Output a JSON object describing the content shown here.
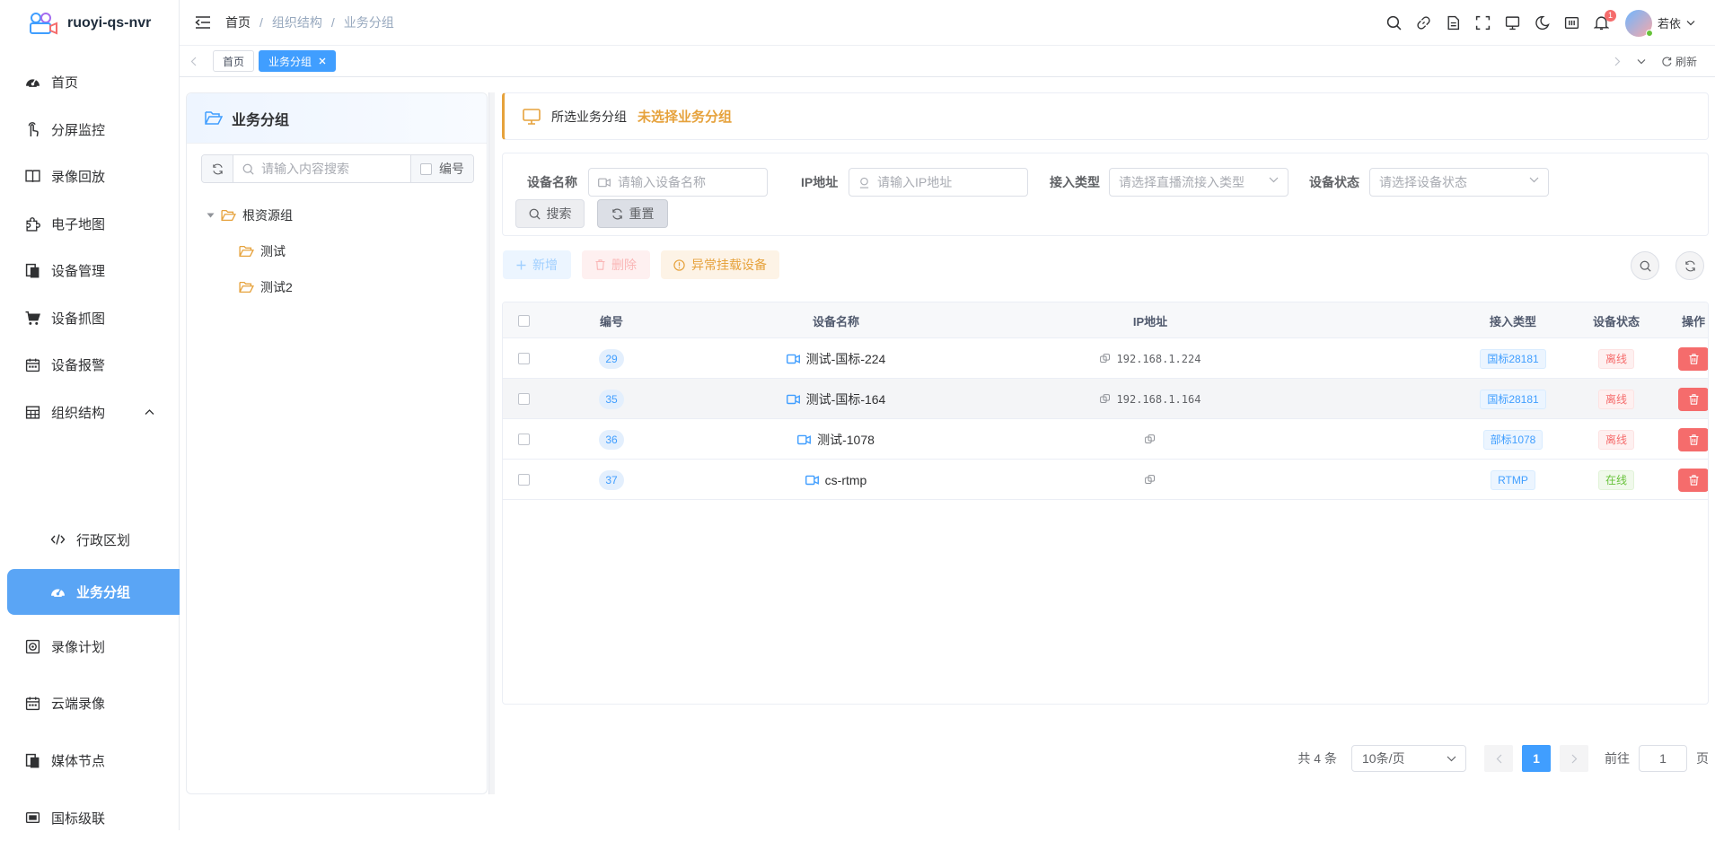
{
  "app": {
    "name": "ruoyi-qs-nvr"
  },
  "sidebar": {
    "items": [
      {
        "label": "首页",
        "icon": "dashboard-icon"
      },
      {
        "label": "分屏监控",
        "icon": "pointer-icon"
      },
      {
        "label": "录像回放",
        "icon": "book-icon"
      },
      {
        "label": "电子地图",
        "icon": "puzzle-icon"
      },
      {
        "label": "设备管理",
        "icon": "documents-icon"
      },
      {
        "label": "设备抓图",
        "icon": "cart-icon"
      },
      {
        "label": "设备报警",
        "icon": "calendar-icon"
      },
      {
        "label": "组织结构",
        "icon": "grid-icon",
        "expanded": true
      },
      {
        "label": "行政区划",
        "icon": "code-icon"
      },
      {
        "label": "业务分组",
        "icon": "dashboard-icon",
        "active": true
      },
      {
        "label": "录像计划",
        "icon": "safe-icon"
      },
      {
        "label": "云端录像",
        "icon": "calendar-icon"
      },
      {
        "label": "媒体节点",
        "icon": "documents-icon"
      },
      {
        "label": "国标级联",
        "icon": "screen-icon"
      }
    ]
  },
  "header": {
    "breadcrumb": [
      "首页",
      "组织结构",
      "业务分组"
    ],
    "notification_count": "1",
    "user_name": "若依"
  },
  "tags": {
    "items": [
      {
        "label": "首页"
      },
      {
        "label": "业务分组",
        "active": true
      }
    ],
    "refresh_label": "刷新"
  },
  "tree": {
    "title": "业务分组",
    "search_placeholder": "请输入内容搜索",
    "checkbox_label": "编号",
    "nodes": [
      {
        "label": "根资源组",
        "level": 0
      },
      {
        "label": "测试",
        "level": 1
      },
      {
        "label": "测试2",
        "level": 1
      }
    ]
  },
  "alert": {
    "label": "所选业务分组",
    "value": "未选择业务分组"
  },
  "filters": {
    "device_name": {
      "label": "设备名称",
      "placeholder": "请输入设备名称"
    },
    "ip": {
      "label": "IP地址",
      "placeholder": "请输入IP地址"
    },
    "access_type": {
      "label": "接入类型",
      "placeholder": "请选择直播流接入类型"
    },
    "status": {
      "label": "设备状态",
      "placeholder": "请选择设备状态"
    },
    "search_label": "搜索",
    "reset_label": "重置"
  },
  "toolbar": {
    "add_label": "新增",
    "delete_label": "删除",
    "abnormal_label": "异常挂载设备"
  },
  "table": {
    "columns": [
      "编号",
      "设备名称",
      "IP地址",
      "接入类型",
      "设备状态",
      "操作"
    ],
    "rows": [
      {
        "id": "29",
        "name": "测试-国标-224",
        "ip": "192.168.1.224",
        "type": "国标28181",
        "status": "离线",
        "status_kind": "offline"
      },
      {
        "id": "35",
        "name": "测试-国标-164",
        "ip": "192.168.1.164",
        "type": "国标28181",
        "status": "离线",
        "status_kind": "offline"
      },
      {
        "id": "36",
        "name": "测试-1078",
        "ip": "",
        "type": "部标1078",
        "status": "离线",
        "status_kind": "offline"
      },
      {
        "id": "37",
        "name": "cs-rtmp",
        "ip": "",
        "type": "RTMP",
        "status": "在线",
        "status_kind": "online"
      }
    ]
  },
  "pagination": {
    "total": "共 4 条",
    "page_size": "10条/页",
    "current": "1",
    "goto_prefix": "前往",
    "goto_value": "1",
    "goto_suffix": "页"
  },
  "colors": {
    "primary": "#409eff",
    "active_menu": "#5aa5f5",
    "warning": "#e6a23c",
    "danger": "#f56c6c",
    "success": "#67c23a"
  }
}
